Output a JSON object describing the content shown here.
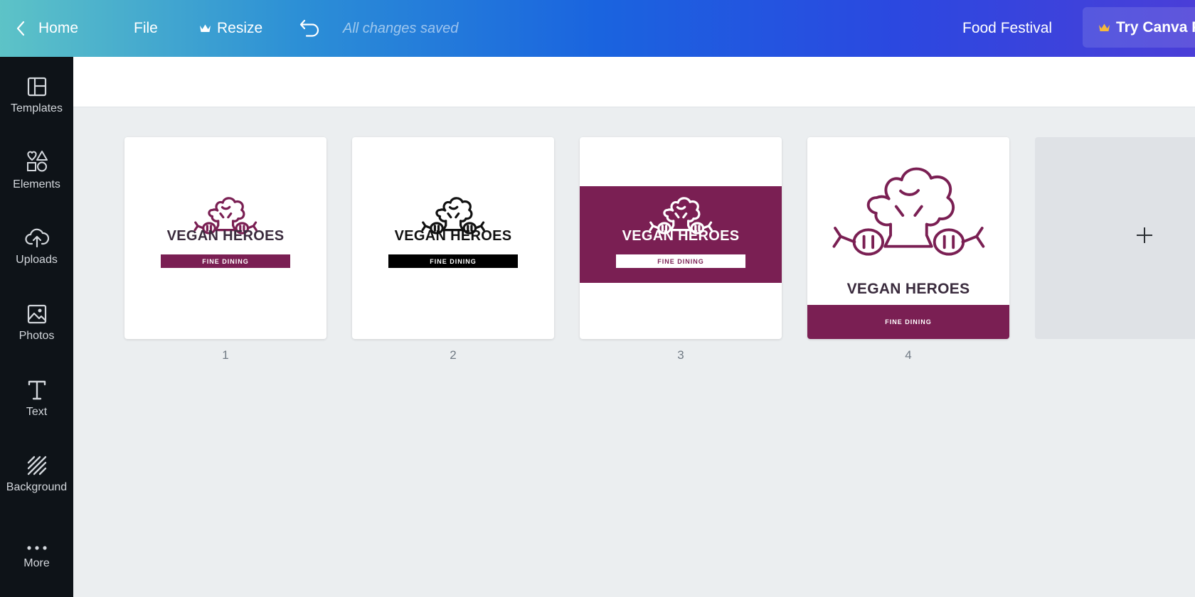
{
  "header": {
    "home_label": "Home",
    "file_label": "File",
    "resize_label": "Resize",
    "save_status": "All changes saved",
    "design_title": "Food Festival",
    "try_label": "Try Canva Pro"
  },
  "sidebar": {
    "items": [
      {
        "label": "Templates",
        "icon": "templates-icon"
      },
      {
        "label": "Elements",
        "icon": "elements-icon"
      },
      {
        "label": "Uploads",
        "icon": "upload-icon"
      },
      {
        "label": "Photos",
        "icon": "photo-icon"
      },
      {
        "label": "Text",
        "icon": "text-icon"
      },
      {
        "label": "Background",
        "icon": "background-icon"
      },
      {
        "label": "More",
        "icon": "more-icon"
      }
    ]
  },
  "pages": [
    {
      "number": "1",
      "title": "VEGAN HEROES",
      "tagline": "FINE DINING"
    },
    {
      "number": "2",
      "title": "VEGAN HEROES",
      "tagline": "FINE DINING"
    },
    {
      "number": "3",
      "title": "VEGAN HEROES",
      "tagline": "FINE DINING"
    },
    {
      "number": "4",
      "title": "VEGAN HEROES",
      "tagline": "FINE DINING"
    }
  ],
  "colors": {
    "brand_purple": "#7a1f53",
    "sidebar_bg": "#0e1318",
    "canvas_bg": "#ebeef0"
  }
}
